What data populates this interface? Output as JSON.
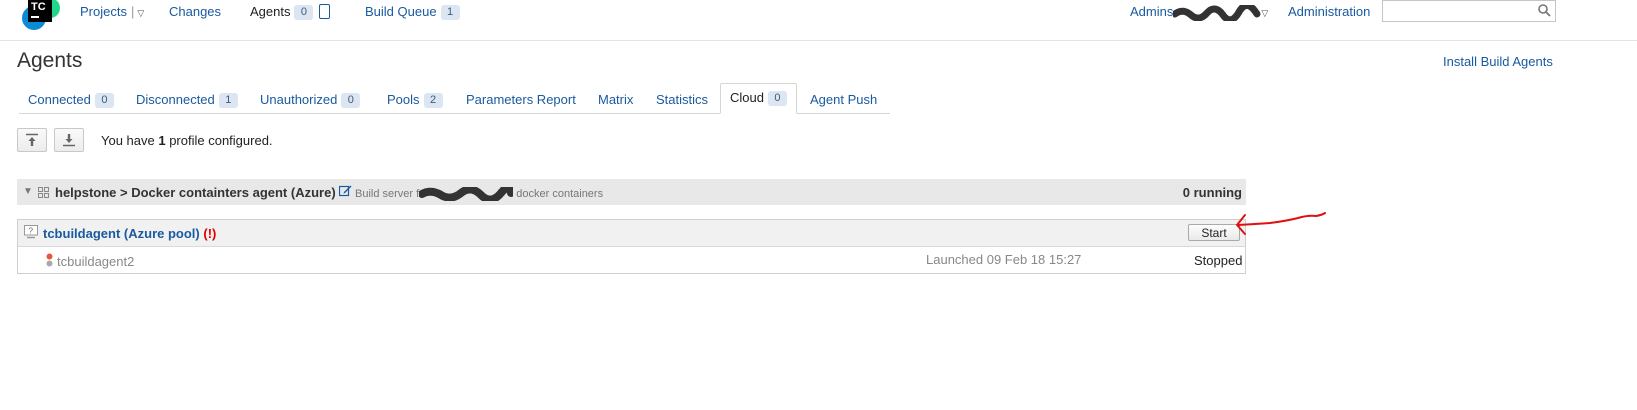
{
  "logo": {
    "text": "TC",
    "colors": [
      "#0b8bd6",
      "#ff3d6b",
      "#000000"
    ]
  },
  "nav": {
    "projects": "Projects",
    "changes": "Changes",
    "agents": "Agents",
    "agents_count": "0",
    "build_queue": "Build Queue",
    "build_queue_count": "1",
    "admin_user": "Admins",
    "administration": "Administration",
    "search_placeholder": ""
  },
  "page": {
    "title": "Agents",
    "install_link": "Install Build Agents"
  },
  "tabs": [
    {
      "label": "Connected",
      "count": "0"
    },
    {
      "label": "Disconnected",
      "count": "1"
    },
    {
      "label": "Unauthorized",
      "count": "0"
    },
    {
      "label": "Pools",
      "count": "2"
    },
    {
      "label": "Parameters Report"
    },
    {
      "label": "Matrix"
    },
    {
      "label": "Statistics"
    },
    {
      "label": "Cloud",
      "count": "0",
      "active": true
    },
    {
      "label": "Agent Push"
    }
  ],
  "toolbar": {
    "text_before": "You have ",
    "count": "1",
    "text_after": " profile configured."
  },
  "profile": {
    "title": "helpstone > Docker containters agent (Azure)",
    "description_start": "Build server f",
    "description_end": "docker containers",
    "running": "0 running"
  },
  "agent": {
    "name": "tcbuildagent",
    "pool": "(Azure pool)",
    "warning": "(!)",
    "start_label": "Start",
    "instance_name": "tcbuildagent2",
    "launched": "Launched 09 Feb 18 15:27",
    "status": "Stopped"
  },
  "colors": {
    "link": "#1a5aa0",
    "warning": "#dd0000",
    "annotation_arrow": "#e01010"
  }
}
